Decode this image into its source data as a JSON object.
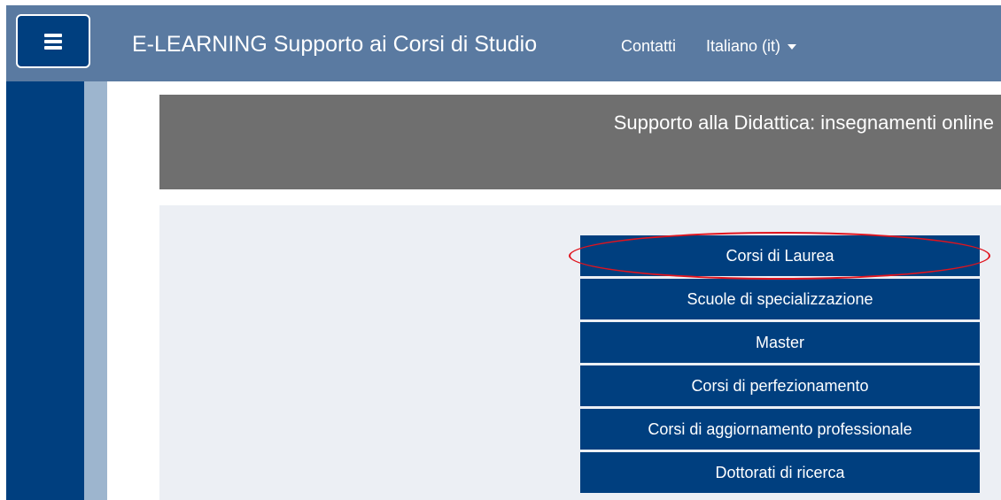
{
  "navbar": {
    "menu_icon": "hamburger-menu-icon",
    "brand": "E-LEARNING Supporto ai Corsi di Studio",
    "links": {
      "contatti": "Contatti",
      "language": "Italiano (it)"
    },
    "caret_icon": "caret-down-icon",
    "colors": {
      "bar": "#5a7aa1",
      "button": "#003f7f"
    }
  },
  "drawer": {
    "colors": {
      "dark": "#003f7f",
      "light": "#9db5ce"
    }
  },
  "banner": {
    "title": "Supporto alla Didattica: insegnamenti online",
    "color": "#6f6f6f"
  },
  "categories": [
    {
      "label": "Corsi di Laurea"
    },
    {
      "label": "Scuole di specializzazione"
    },
    {
      "label": "Master"
    },
    {
      "label": "Corsi di perfezionamento"
    },
    {
      "label": "Corsi di aggiornamento professionale"
    },
    {
      "label": "Dottorati di ricerca"
    }
  ],
  "annotation": {
    "highlight_color": "#e0141e",
    "highlighted": "Corsi di Laurea"
  }
}
